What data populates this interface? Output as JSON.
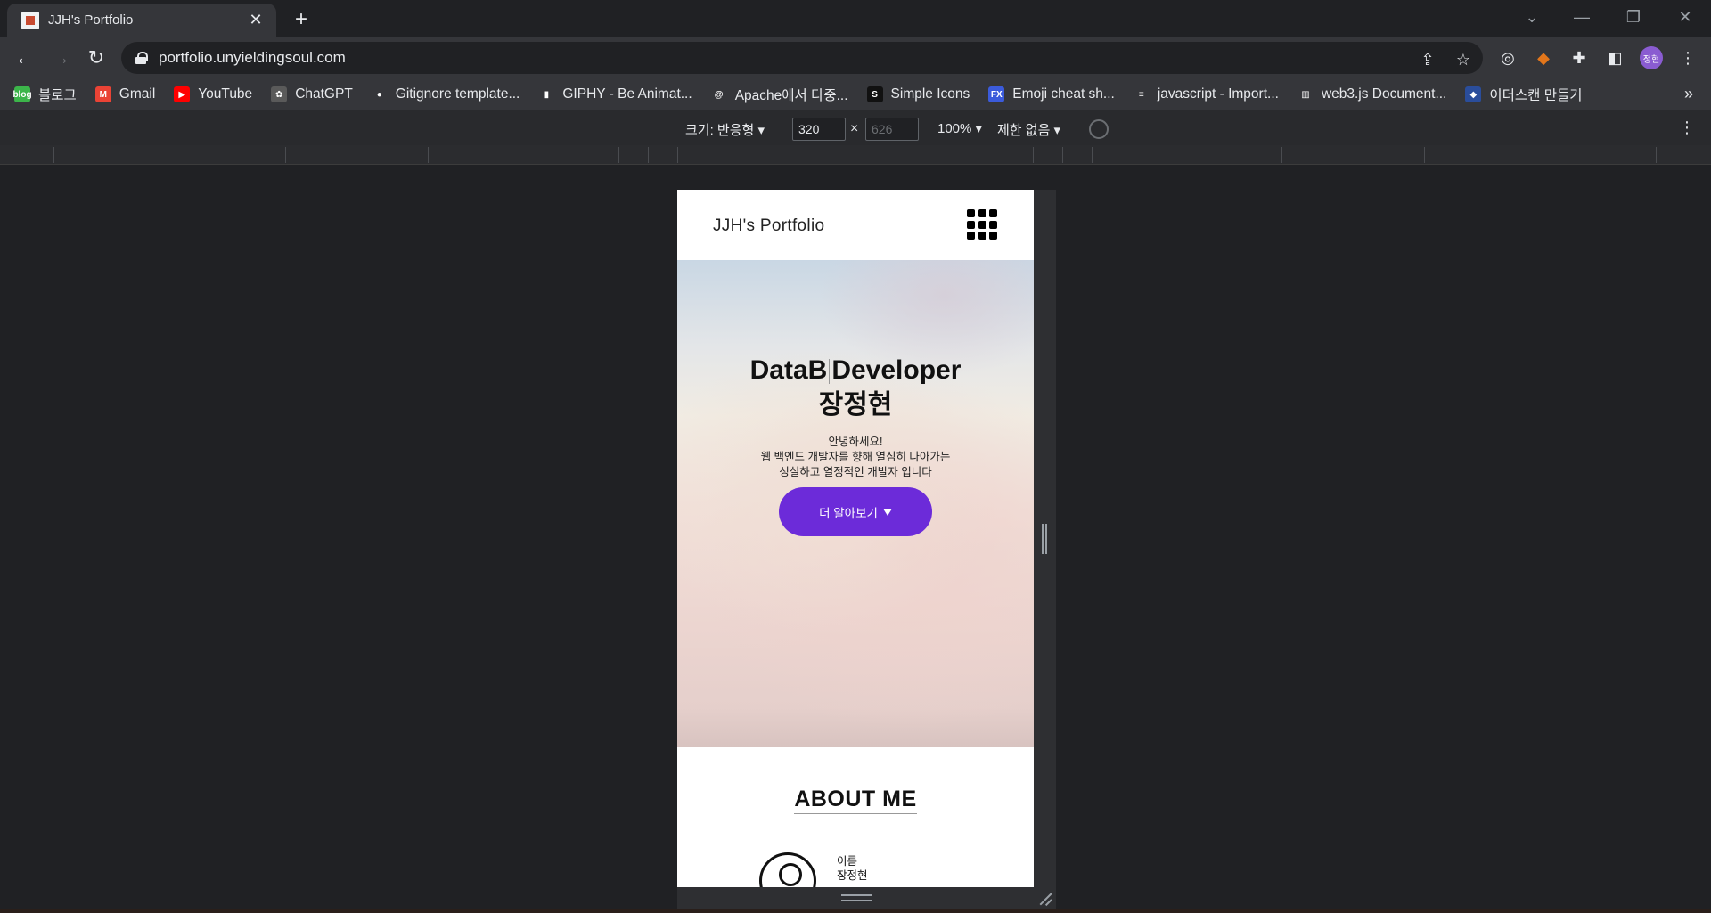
{
  "browser": {
    "tab_title": "JJH's Portfolio",
    "tab_close": "✕",
    "new_tab": "+",
    "url": "portfolio.unyieldingsoul.com",
    "profile_initials": "정현",
    "bookmarks": [
      {
        "label": "블로그",
        "icon": "blog-icon",
        "color": "#3cb54a",
        "icon_text": "blog"
      },
      {
        "label": "Gmail",
        "icon": "gmail-icon",
        "color": "#ea4335",
        "icon_text": "M"
      },
      {
        "label": "YouTube",
        "icon": "youtube-icon",
        "color": "#ff0000",
        "icon_text": "▶"
      },
      {
        "label": "ChatGPT",
        "icon": "chatgpt-icon",
        "color": "#5a5a5a",
        "icon_text": "✿"
      },
      {
        "label": "Gitignore template...",
        "icon": "github-icon",
        "color": "#35363a",
        "icon_text": "●"
      },
      {
        "label": "GIPHY - Be Animat...",
        "icon": "giphy-icon",
        "color": "#35363a",
        "icon_text": "▮"
      },
      {
        "label": "Apache에서 다중...",
        "icon": "at-icon",
        "color": "#35363a",
        "icon_text": "@"
      },
      {
        "label": "Simple Icons",
        "icon": "simple-icons-icon",
        "color": "#111111",
        "icon_text": "S"
      },
      {
        "label": "Emoji cheat sh...",
        "icon": "emoji-gift-icon",
        "color": "#3b5bdb",
        "icon_text": "FX"
      },
      {
        "label": "javascript - Import...",
        "icon": "stackoverflow-icon",
        "color": "#35363a",
        "icon_text": "≡"
      },
      {
        "label": "web3.js Document...",
        "icon": "docs-icon",
        "color": "#35363a",
        "icon_text": "▥"
      },
      {
        "label": "이더스캔 만들기",
        "icon": "cube-icon",
        "color": "#2a4d9b",
        "icon_text": "◆"
      }
    ],
    "bookmarks_more": "»"
  },
  "devtools": {
    "size_label": "크기: 반응형 ▾",
    "width": "320",
    "height": "626",
    "times": "×",
    "zoom": "100% ▾",
    "throttle": "제한 없음 ▾",
    "menu": "⋮"
  },
  "site": {
    "logo": "JJH's Portfolio",
    "hero": {
      "title_part1": "DataB",
      "title_part2": "Developer",
      "title_line2": "장정현",
      "text_line1": "안녕하세요!",
      "text_line2": "웹 백엔드 개발자를 향해 열심히 나아가는",
      "text_line3": "성실하고 열정적인 개발자 입니다",
      "button_label": "더 알아보기"
    },
    "about": {
      "title": "ABOUT ME",
      "name_label": "이름",
      "name_value": "장정현"
    }
  },
  "colors": {
    "accent_button": "#6c2bd9",
    "browser_bg": "#202124",
    "toolbar_bg": "#35363a"
  }
}
